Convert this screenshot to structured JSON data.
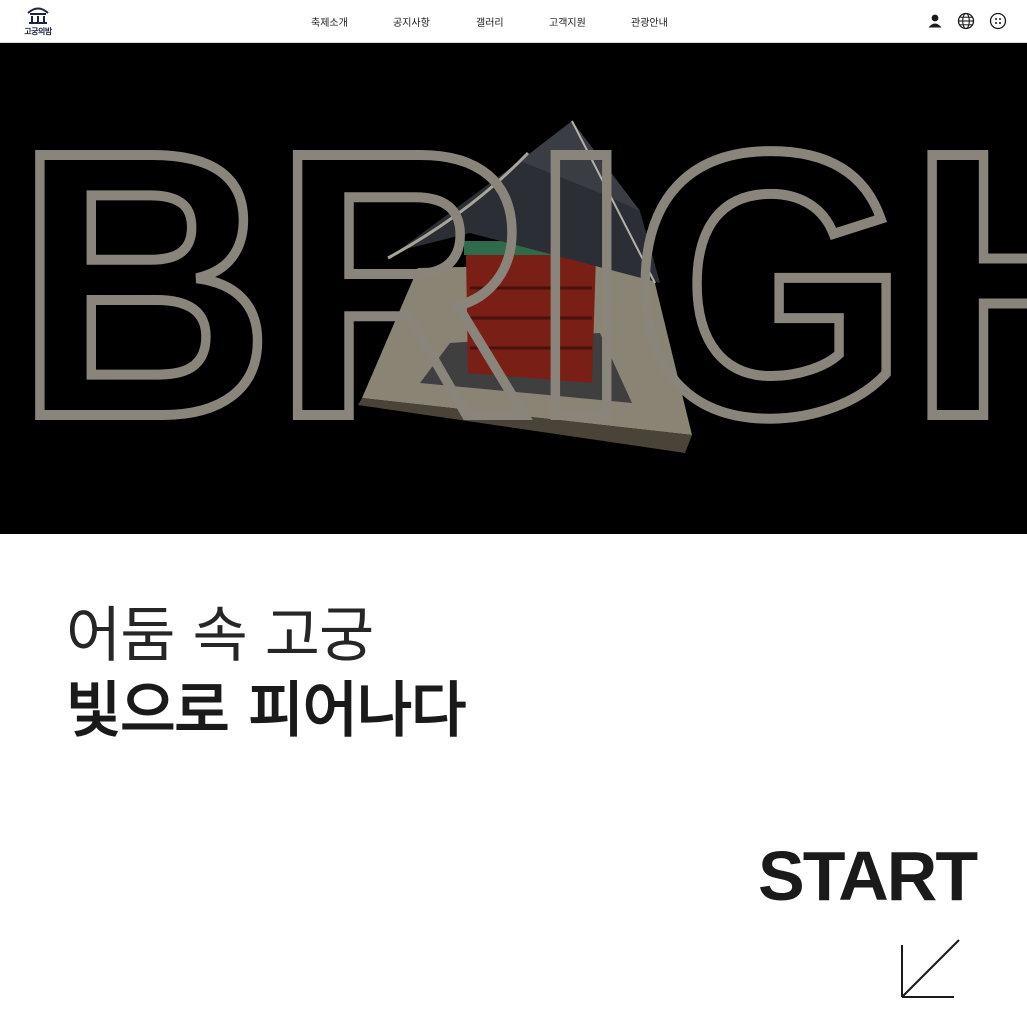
{
  "header": {
    "logo_text": "고궁의밤",
    "nav": [
      "축제소개",
      "공지사항",
      "갤러리",
      "고객지원",
      "관광안내"
    ],
    "icons": [
      "user-icon",
      "globe-icon",
      "menu-dots-icon"
    ]
  },
  "hero": {
    "outline_text": "BRIGH",
    "outline_color": "#8a857b",
    "background": "#000000"
  },
  "main": {
    "headline_light": "어둠 속 고궁",
    "headline_bold": "빛으로 피어나다",
    "start_label": "START",
    "start_icon": "arrow-down-left-icon"
  }
}
